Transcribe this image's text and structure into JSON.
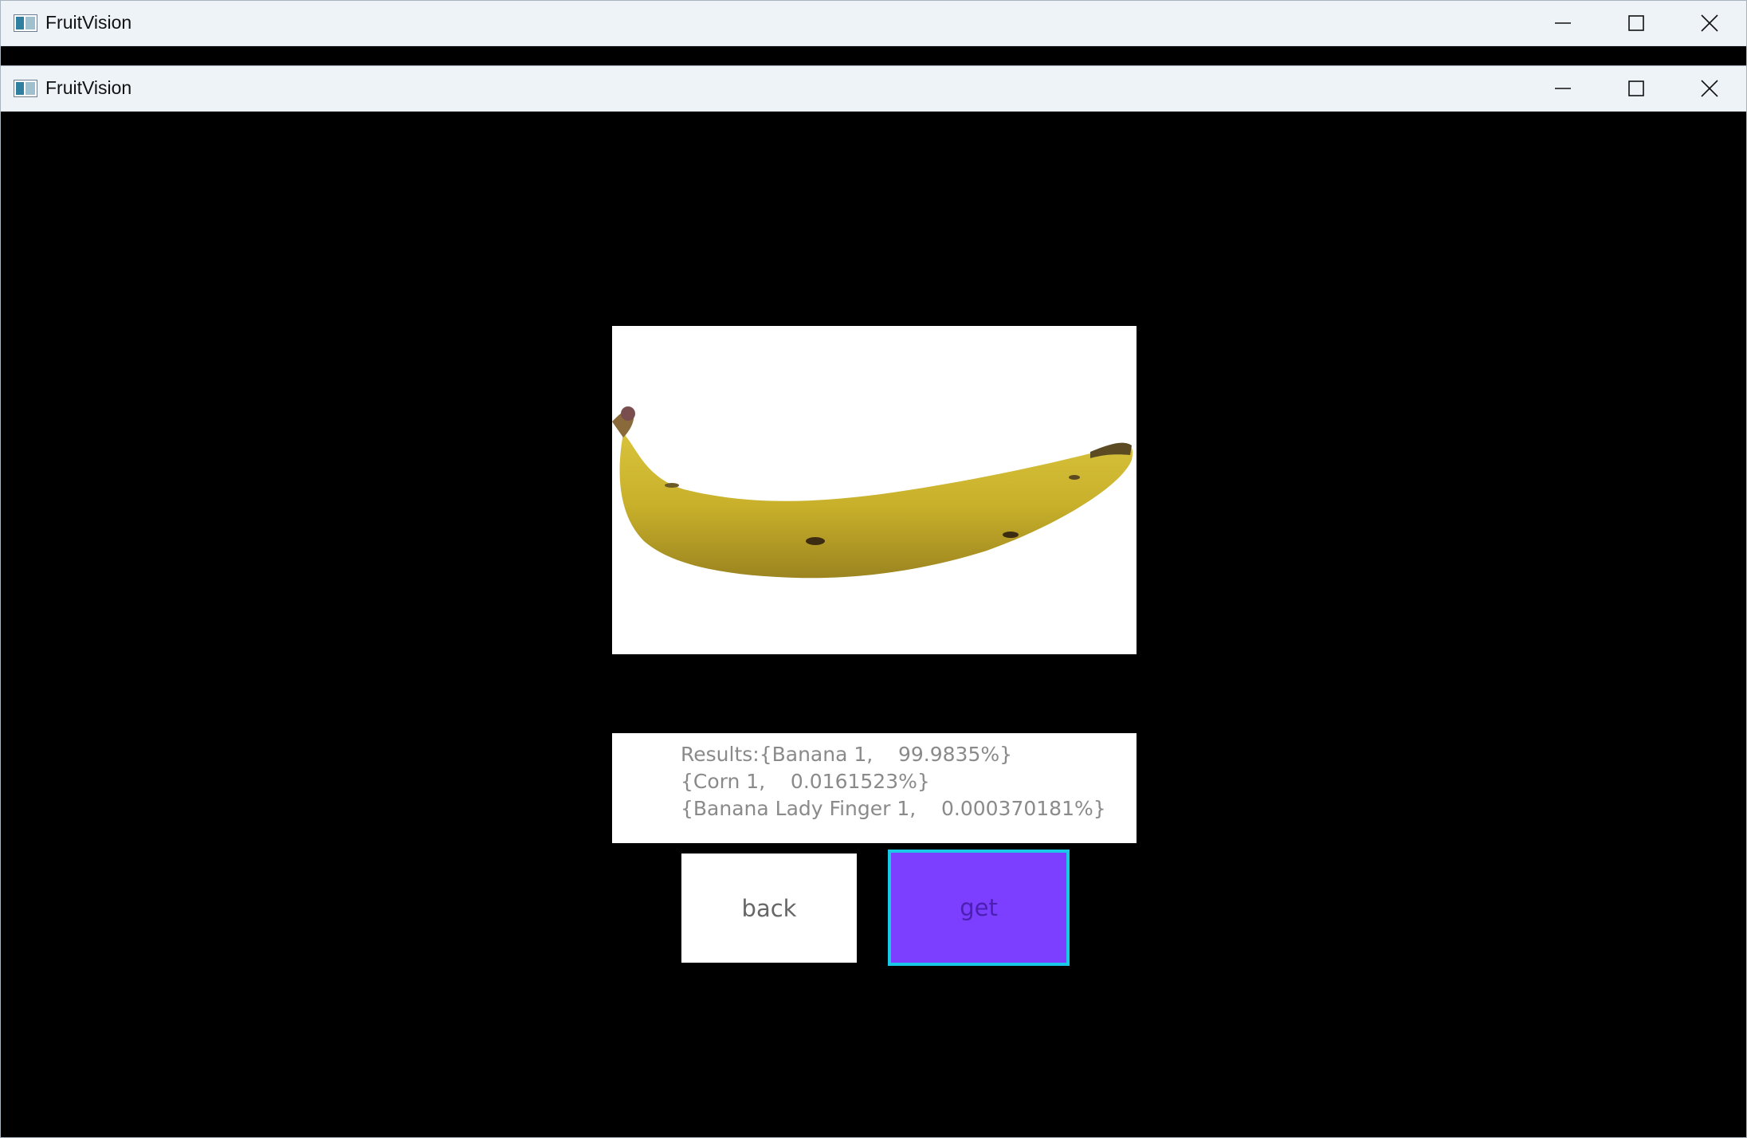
{
  "background_window": {
    "title": "FruitVision",
    "controls": {
      "minimize": "minimize-icon",
      "maximize": "maximize-icon",
      "close": "close-icon"
    }
  },
  "main_window": {
    "title": "FruitVision",
    "controls": {
      "minimize": "minimize-icon",
      "maximize": "maximize-icon",
      "close": "close-icon"
    }
  },
  "image": {
    "subject": "banana-image"
  },
  "results": {
    "lines": [
      "Results:{Banana 1,    99.9835%}",
      "{Corn 1,    0.0161523%}",
      "{Banana Lady Finger 1,    0.000370181%}"
    ]
  },
  "buttons": {
    "back_label": "back",
    "get_label": "get"
  },
  "colors": {
    "get_button_bg": "#7c3fff",
    "get_button_border": "#19c7e6",
    "window_bg": "#000000",
    "titlebar_bg": "#eef3f8"
  }
}
